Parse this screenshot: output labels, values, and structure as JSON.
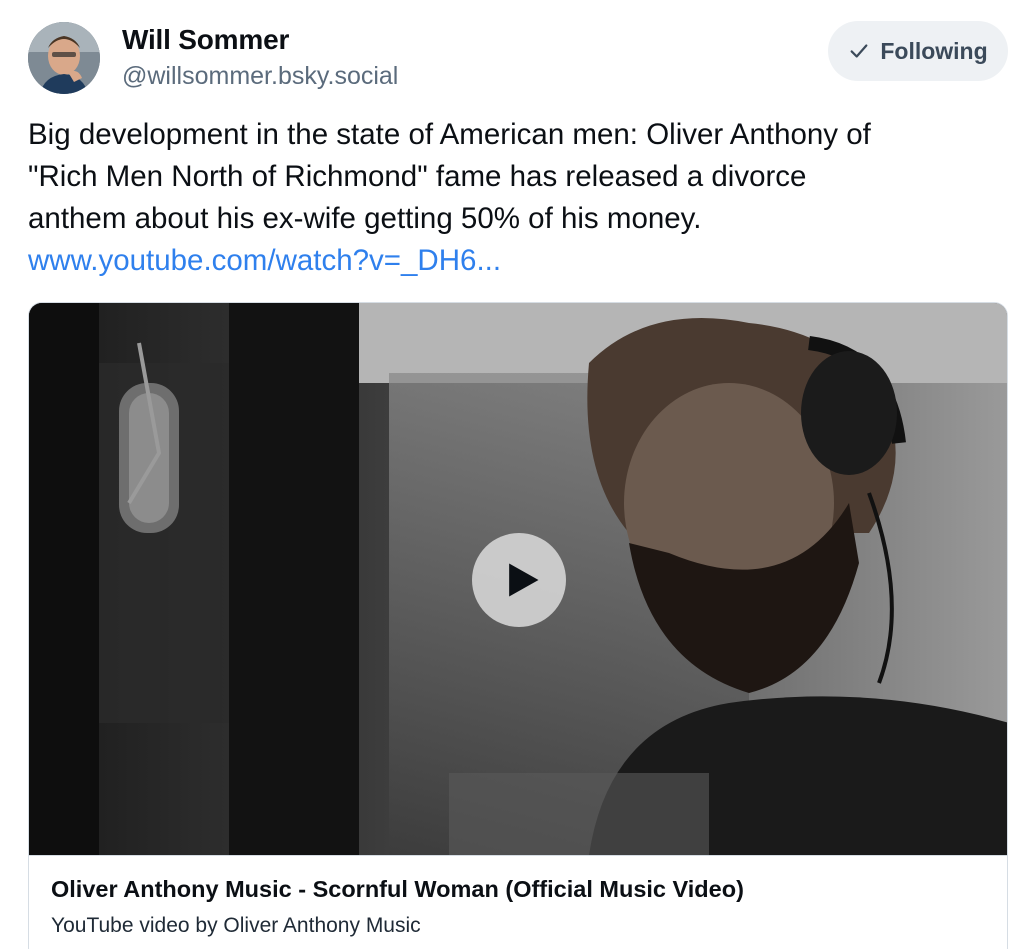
{
  "author": {
    "display_name": "Will Sommer",
    "handle": "@willsommer.bsky.social",
    "avatar_icon": "profile-photo"
  },
  "follow_button": {
    "label": "Following",
    "icon": "check-icon"
  },
  "post": {
    "text": "Big development in the state of American men: Oliver Anthony of\n\"Rich Men North of Richmond\" fame has released a divorce\nanthem about his ex-wife getting 50% of his money.",
    "link_text": "www.youtube.com/watch?v=_DH6..."
  },
  "embed": {
    "title": "Oliver Anthony Music - Scornful Woman (Official Music Video)",
    "description": "YouTube video by Oliver Anthony Music",
    "play_icon": "play-icon"
  },
  "colors": {
    "link": "#2f80ed",
    "handle": "#5b6b7c",
    "button_bg": "#eef1f4",
    "button_text": "#3b4a5a"
  }
}
